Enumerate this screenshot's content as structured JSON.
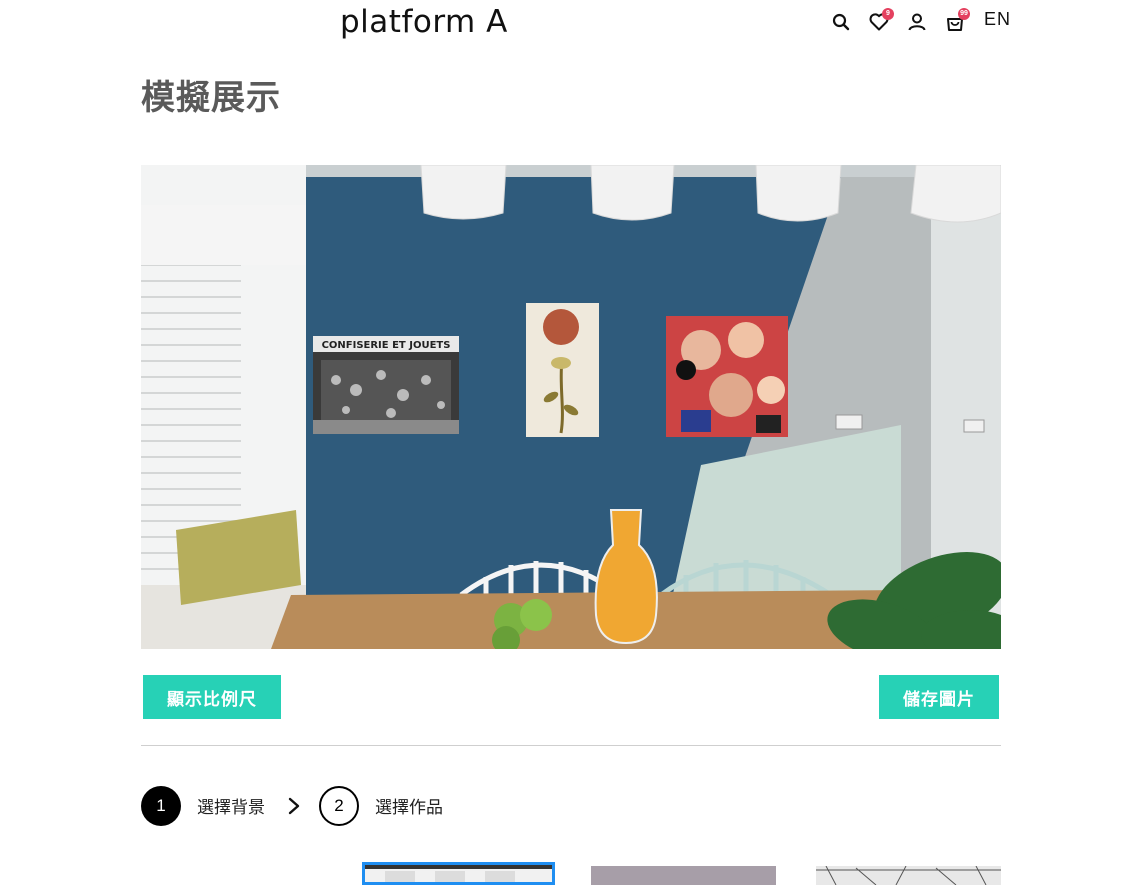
{
  "header": {
    "logo_text": "platform A",
    "icons": [
      "search-icon",
      "heart-icon",
      "user-icon",
      "cart-icon"
    ],
    "wishlist_badge": "9",
    "cart_badge": "99",
    "language": "EN"
  },
  "page": {
    "title": "模擬展示"
  },
  "preview": {
    "artworks": [
      {
        "name": "CONFISERIE ET JOUETS",
        "kind": "black-and-white photograph of a shop front"
      },
      {
        "name": "flower-and-sun",
        "kind": "painting of a plant under a red circle"
      },
      {
        "name": "collage",
        "kind": "colorful collage of faces"
      }
    ],
    "artwork1_sign": "CONFISERIE ET JOUETS"
  },
  "actions": {
    "show_scale_label": "顯示比例尺",
    "save_image_label": "儲存圖片"
  },
  "steps": [
    {
      "number": "1",
      "label": "選擇背景",
      "active": true
    },
    {
      "number": "2",
      "label": "選擇作品",
      "active": false
    }
  ],
  "thumbnails": [
    {
      "name": "dining-room",
      "selected": true
    },
    {
      "name": "purple-wall",
      "selected": false
    },
    {
      "name": "sketch-wall",
      "selected": false
    }
  ],
  "colors": {
    "accent": "#27d1b6",
    "badge": "#e4405f",
    "selected_border": "#1f8ef1",
    "title": "#5a5a5a"
  }
}
